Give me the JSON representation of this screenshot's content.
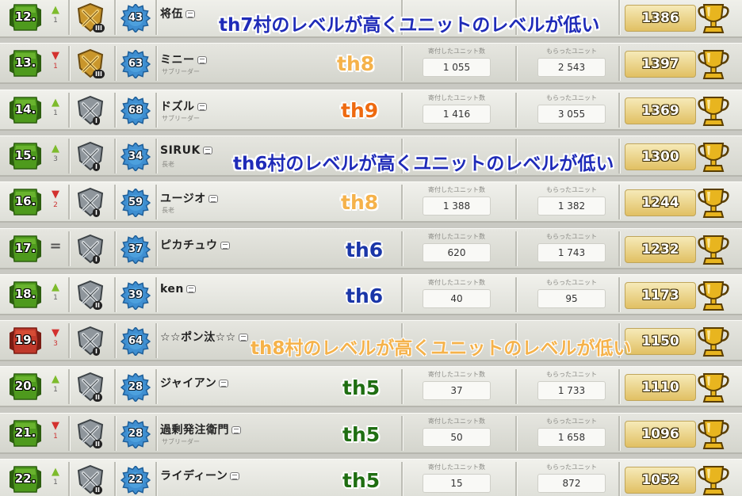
{
  "labels": {
    "donated": "寄付したユニット数",
    "received": "もらったユニット"
  },
  "colors": {
    "annotation_navy": "#1f2bb8",
    "annotation_orange": "#f5b24a",
    "annotation_dark_orange": "#ee6a10",
    "annotation_green": "#1f6e12",
    "annotation_blue": "#1a36a8"
  },
  "members": [
    {
      "rank": "12.",
      "trend": "up",
      "change": "1",
      "league": "gold-league-3",
      "league_tier": "III",
      "level": "43",
      "name": "将伍",
      "role": "",
      "donated": "",
      "received": "",
      "trophies": "1386"
    },
    {
      "rank": "13.",
      "trend": "down",
      "change": "1",
      "league": "gold-league-3",
      "league_tier": "III",
      "level": "63",
      "name": "ミニー",
      "role": "サブリーダー",
      "donated": "1 055",
      "received": "2 543",
      "trophies": "1397"
    },
    {
      "rank": "14.",
      "trend": "up",
      "change": "1",
      "league": "silver-league-1",
      "league_tier": "I",
      "level": "68",
      "name": "ドズル",
      "role": "サブリーダー",
      "donated": "1 416",
      "received": "3 055",
      "trophies": "1369"
    },
    {
      "rank": "15.",
      "trend": "up",
      "change": "3",
      "league": "silver-league-1",
      "league_tier": "I",
      "level": "34",
      "name": "SIRUK",
      "role": "長老",
      "donated": "",
      "received": "",
      "trophies": "1300"
    },
    {
      "rank": "16.",
      "trend": "down",
      "change": "2",
      "league": "silver-league-1",
      "league_tier": "I",
      "level": "59",
      "name": "ユージオ",
      "role": "長老",
      "donated": "1 388",
      "received": "1 382",
      "trophies": "1244"
    },
    {
      "rank": "17.",
      "trend": "same",
      "change": "",
      "league": "silver-league-1",
      "league_tier": "I",
      "level": "37",
      "name": "ピカチュウ",
      "role": "",
      "donated": "620",
      "received": "1 743",
      "trophies": "1232"
    },
    {
      "rank": "18.",
      "trend": "up",
      "change": "1",
      "league": "silver-league-2",
      "league_tier": "II",
      "level": "39",
      "name": "ken",
      "role": "",
      "donated": "40",
      "received": "95",
      "trophies": "1173"
    },
    {
      "rank": "19.",
      "trend": "down",
      "change": "3",
      "league": "silver-league-1",
      "league_tier": "I",
      "level": "64",
      "name": "☆☆ポン汰☆☆",
      "role": "",
      "donated": "",
      "received": "",
      "trophies": "1150"
    },
    {
      "rank": "20.",
      "trend": "up",
      "change": "1",
      "league": "silver-league-2",
      "league_tier": "II",
      "level": "28",
      "name": "ジャイアン",
      "role": "",
      "donated": "37",
      "received": "1 733",
      "trophies": "1110"
    },
    {
      "rank": "21.",
      "trend": "down",
      "change": "1",
      "league": "silver-league-2",
      "league_tier": "II",
      "level": "28",
      "name": "過剰発注衛門",
      "role": "サブリーダー",
      "donated": "50",
      "received": "1 658",
      "trophies": "1096"
    },
    {
      "rank": "22.",
      "trend": "up",
      "change": "1",
      "league": "silver-league-2",
      "league_tier": "II",
      "level": "22",
      "name": "ライディーン",
      "role": "",
      "donated": "15",
      "received": "872",
      "trophies": "1052"
    }
  ],
  "annotations": [
    {
      "text": "th7村のレベルが高くユニットのレベルが低い",
      "color": "#1f2bb8",
      "style": "dark"
    },
    {
      "text": "th8",
      "color": "#f5b24a",
      "style": "th"
    },
    {
      "text": "th9",
      "color": "#ee6a10",
      "style": "th"
    },
    {
      "text": "th6村のレベルが高くユニットのレベルが低い",
      "color": "#1f2bb8",
      "style": "dark"
    },
    {
      "text": "th8",
      "color": "#f5b24a",
      "style": "th"
    },
    {
      "text": "th6",
      "color": "#1a36a8",
      "style": "th"
    },
    {
      "text": "th6",
      "color": "#1a36a8",
      "style": "th"
    },
    {
      "text": "th8村のレベルが高くユニットのレベルが低い",
      "color": "#f5b24a",
      "style": "light"
    },
    {
      "text": "th5",
      "color": "#1f6e12",
      "style": "th"
    },
    {
      "text": "th5",
      "color": "#1f6e12",
      "style": "th"
    },
    {
      "text": "th5",
      "color": "#1f6e12",
      "style": "th"
    }
  ]
}
